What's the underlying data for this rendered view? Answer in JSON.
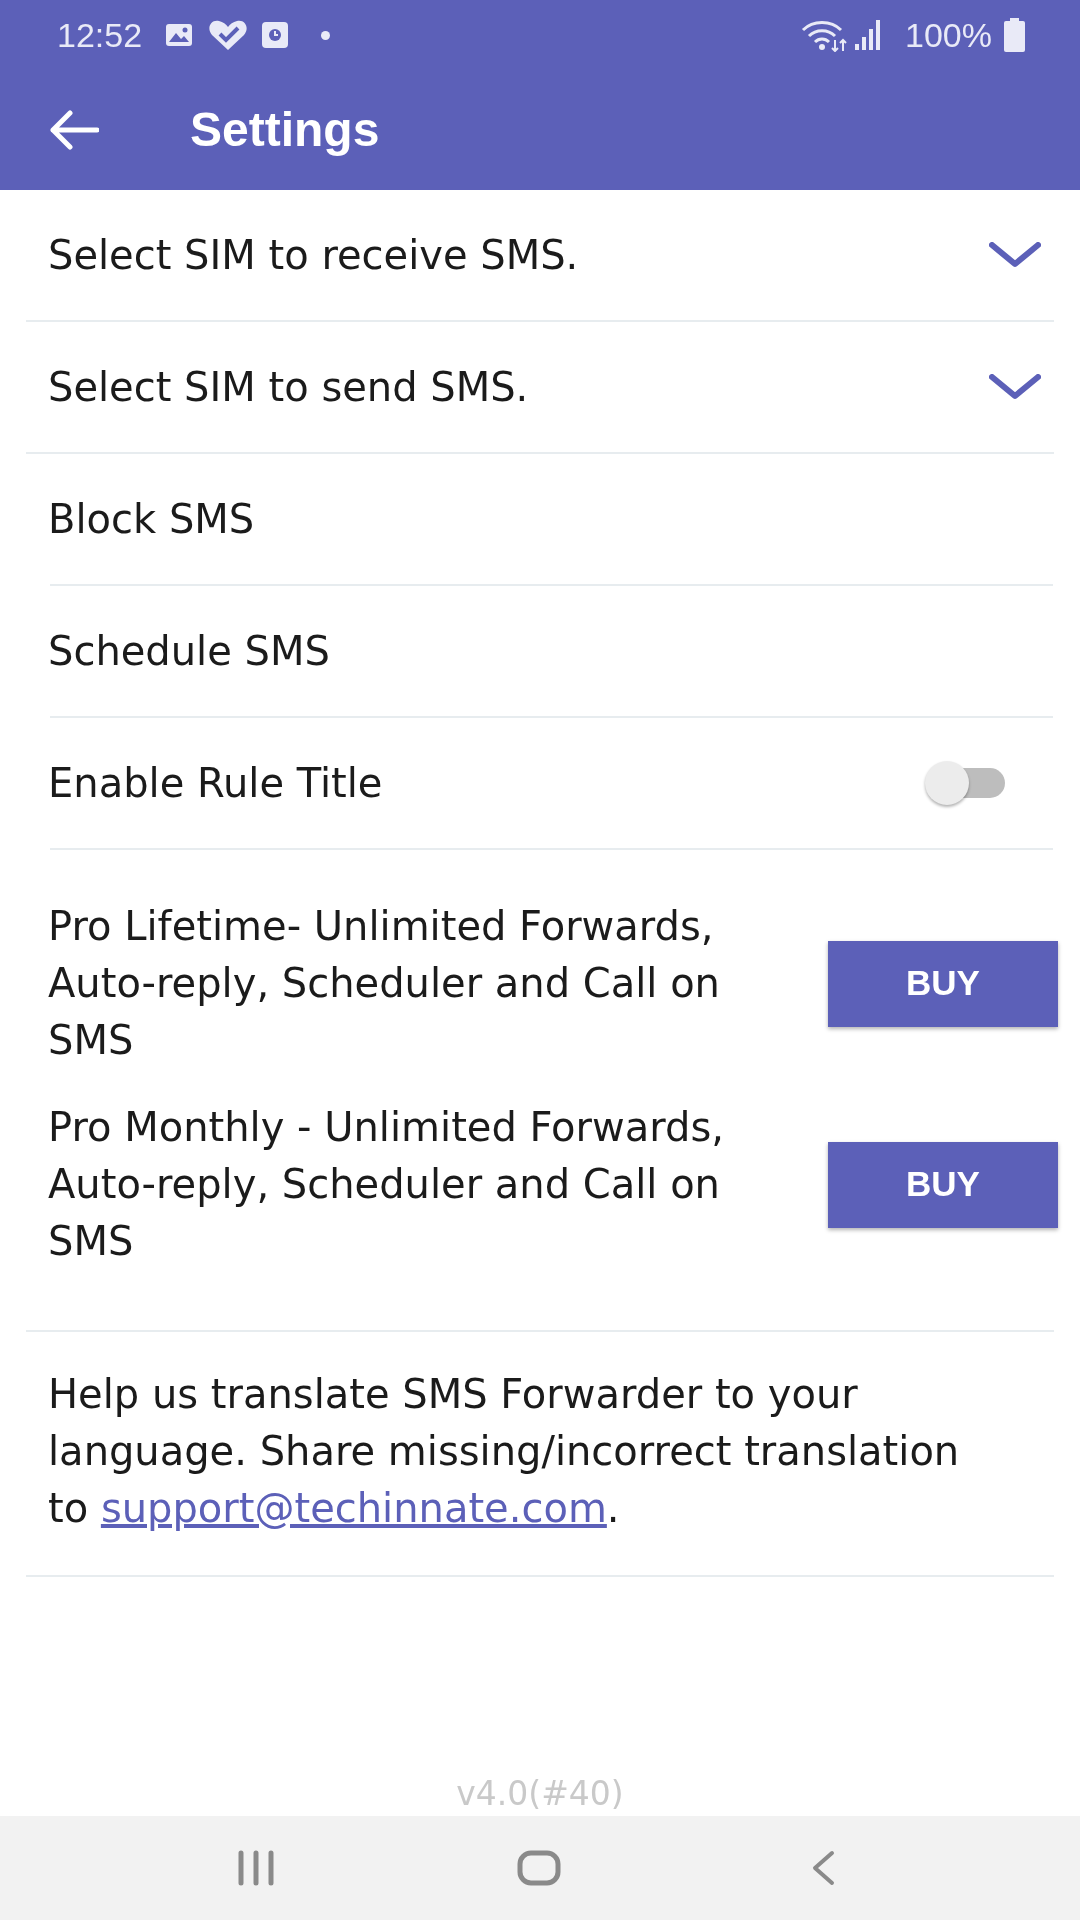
{
  "status_bar": {
    "time": "12:52",
    "battery": "100%"
  },
  "app_bar": {
    "title": "Settings"
  },
  "settings": [
    {
      "kind": "dropdown",
      "label": "Select SIM to receive SMS."
    },
    {
      "kind": "dropdown",
      "label": "Select SIM to send SMS."
    },
    {
      "kind": "link",
      "label": "Block SMS"
    },
    {
      "kind": "link",
      "label": "Schedule SMS"
    },
    {
      "kind": "toggle",
      "label": "Enable Rule Title",
      "on": false
    }
  ],
  "purchases": [
    {
      "description": "Pro Lifetime- Unlimited Forwards, Auto-reply, Scheduler and Call on SMS",
      "button": "BUY"
    },
    {
      "description": "Pro Monthly - Unlimited Forwards, Auto-reply, Scheduler and Call on SMS",
      "button": "BUY"
    }
  ],
  "help": {
    "text": "Help us translate SMS Forwarder to your language. Share missing/incorrect translation to",
    "email": "support@techinnate.com",
    "end": "."
  },
  "version": "v4.0(#40)"
}
